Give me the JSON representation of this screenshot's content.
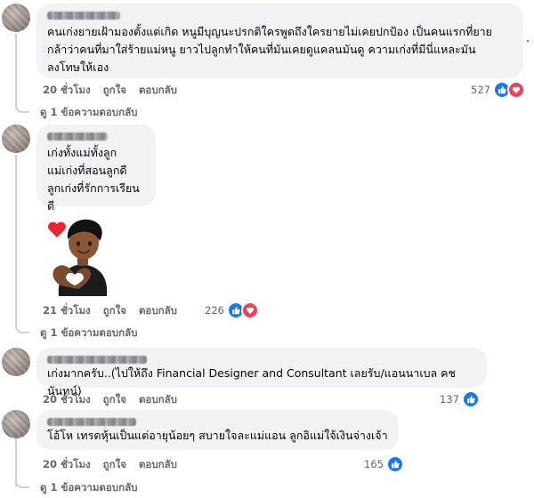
{
  "comments": [
    {
      "text": "คนเก่งยายเฝ้ามองตั้งแต่เกิด หนูมีบุญนะปรกติใครพูดถึงใครยายไม่เคยปกป้อง เป็นคนแรกที่ยาย\nกล้าว่าคนที่มาใส่ร้ายแม่หนู ยาวไปลูกทำให้คนที่มันเคยดูแคลนมันดู ความเก่งที่มีนี่แหละมัน\nลงโทษให้เอง",
      "time": "20 ชั่วโมง",
      "like": "ถูกใจ",
      "reply": "ตอบกลับ",
      "reaction_count": "527",
      "reactions": [
        "like",
        "love"
      ],
      "view_replies": "ดู 1 ข้อความตอบกลับ"
    },
    {
      "text": "เก่งทั้งแม่ทั้งลูก\nแม่เก่งที่สอนลูกดี\nลูกเก่งที่รักการเรียนดี",
      "time": "21 ชั่วโมง",
      "like": "ถูกใจ",
      "reply": "ตอบกลับ",
      "reaction_count": "226",
      "reactions": [
        "like",
        "love"
      ],
      "view_replies": "ดู 1 ข้อความตอบกลับ"
    },
    {
      "text": "เก่งมากครับ..(ไปให้ถึง Financial Designer and Consultant เลยรับ/แอนนาเบล คชนันทน์)",
      "time": "20 ชั่วโมง",
      "like": "ถูกใจ",
      "reply": "ตอบกลับ",
      "reaction_count": "137",
      "reactions": [
        "like"
      ]
    },
    {
      "text": "โอ้โห เทรดหุ้นเป็นแต่อายุน้อยๆ สบายใจละแม่แอน ลูกอิแม่ใจ้เงินจ่างเจ้า",
      "time": "20 ชั่วโมง",
      "like": "ถูกใจ",
      "reply": "ตอบกลับ",
      "reaction_count": "165",
      "reactions": [
        "like"
      ],
      "view_replies": "ดู 1 ข้อความตอบกลับ"
    }
  ],
  "colors": {
    "like": "#1877f2",
    "love": "#f33e58",
    "bubble": "#f0f2f5",
    "meta": "#65676b"
  },
  "icons": {
    "like": "thumbs-up-icon",
    "love": "heart-icon",
    "sticker": "avatar-heart-sticker"
  }
}
